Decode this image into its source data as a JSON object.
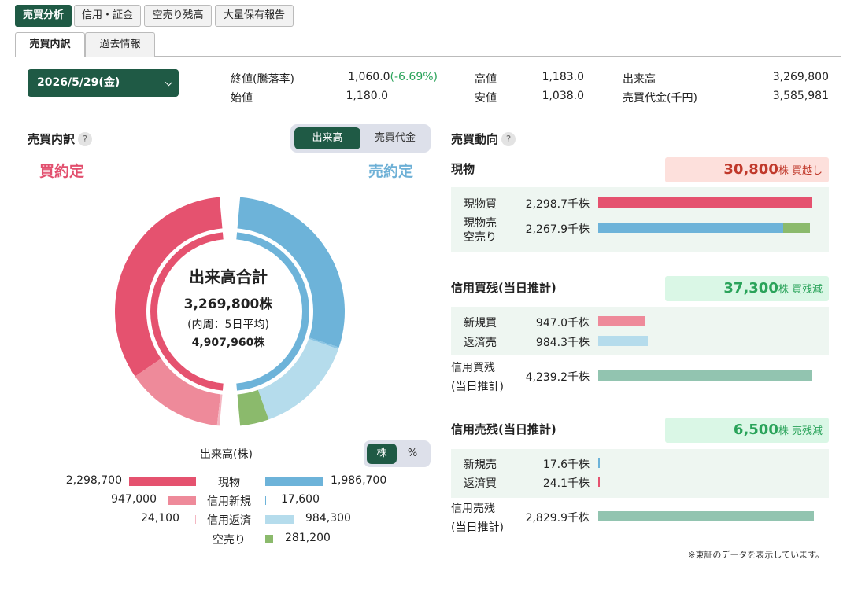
{
  "top_tabs": [
    "売買分析",
    "信用・証金",
    "空売り残高",
    "大量保有報告"
  ],
  "sub_tabs": [
    "売買内訳",
    "過去情報"
  ],
  "date_select": {
    "value": "2026/5/29(金)"
  },
  "prices": {
    "close_label": "終値(騰落率)",
    "close_value": "1,060.0",
    "close_change": "(-6.69%)",
    "open_label": "始値",
    "open_value": "1,180.0",
    "high_label": "高値",
    "high_value": "1,183.0",
    "low_label": "安値",
    "low_value": "1,038.0",
    "volume_label": "出来高",
    "volume_value": "3,269,800",
    "turnover_label": "売買代金(千円)",
    "turnover_value": "3,585,981"
  },
  "breakdown": {
    "title": "売買内訳",
    "help": "?",
    "toggle": [
      "出来高",
      "売買代金"
    ],
    "buy_title": "買約定",
    "sell_title": "売約定",
    "center_title": "出来高合計",
    "center_total": "3,269,800株",
    "center_inner": "(内周：5日平均)",
    "center_avg": "4,907,960株",
    "unit_label": "出来高(株)",
    "unit_toggle": [
      "株",
      "%"
    ]
  },
  "chart_data": {
    "type": "pie",
    "title": "出来高合計",
    "colors": {
      "buy_cash": "#e5526f",
      "buy_margin_new": "#ee8a9a",
      "buy_margin_close": "#f4b7c2",
      "sell_cash": "#6db3d9",
      "sell_margin_new": "#8cc6e4",
      "sell_margin_close": "#b5dcec",
      "short": "#8bba6c"
    },
    "buy_side": [
      {
        "name": "現物",
        "value": 2298700
      },
      {
        "name": "信用新規",
        "value": 947000
      },
      {
        "name": "信用返済",
        "value": 24100
      }
    ],
    "sell_side": [
      {
        "name": "現物",
        "value": 1986700
      },
      {
        "name": "信用新規",
        "value": 17600
      },
      {
        "name": "信用返済",
        "value": 984300
      },
      {
        "name": "空売り",
        "value": 281200
      }
    ]
  },
  "legend": [
    {
      "buy": "2,298,700",
      "label": "現物",
      "sell": "1,986,700"
    },
    {
      "buy": "947,000",
      "label": "信用新規",
      "sell": "17,600"
    },
    {
      "buy": "24,100",
      "label": "信用返済",
      "sell": "984,300"
    },
    {
      "buy": "",
      "label": "空売り",
      "sell": "281,200"
    }
  ],
  "trend": {
    "title": "売買動向",
    "help": "?",
    "cash": {
      "title": "現物",
      "badge_num": "30,800",
      "badge_unit": "株 買越し",
      "rows": [
        {
          "label": "現物買",
          "value": "2,298.7千株",
          "ratio": 1.0
        },
        {
          "label": "現物売",
          "label2": "空売り",
          "value": "2,267.9千株",
          "ratio": 0.986,
          "short_ratio": 0.122
        }
      ]
    },
    "margin_buy": {
      "title": "信用買残(当日推計)",
      "badge_num": "37,300",
      "badge_unit": "株 買残減",
      "rows": [
        {
          "label": "新規買",
          "value": "947.0千株",
          "ratio": 0.224
        },
        {
          "label": "返済売",
          "value": "984.3千株",
          "ratio": 0.232
        },
        {
          "label": "信用買残",
          "label2": "(当日推計)",
          "value": "4,239.2千株",
          "ratio": 1.0
        }
      ]
    },
    "margin_sell": {
      "title": "信用売残(当日推計)",
      "badge_num": "6,500",
      "badge_unit": "株 売残減",
      "rows": [
        {
          "label": "新規売",
          "value": "17.6千株",
          "ratio": 0.006
        },
        {
          "label": "返済買",
          "value": "24.1千株",
          "ratio": 0.008
        },
        {
          "label": "信用売残",
          "label2": "(当日推計)",
          "value": "2,829.9千株",
          "ratio": 1.0
        }
      ]
    },
    "footnote": "※東証のデータを表示しています。"
  }
}
